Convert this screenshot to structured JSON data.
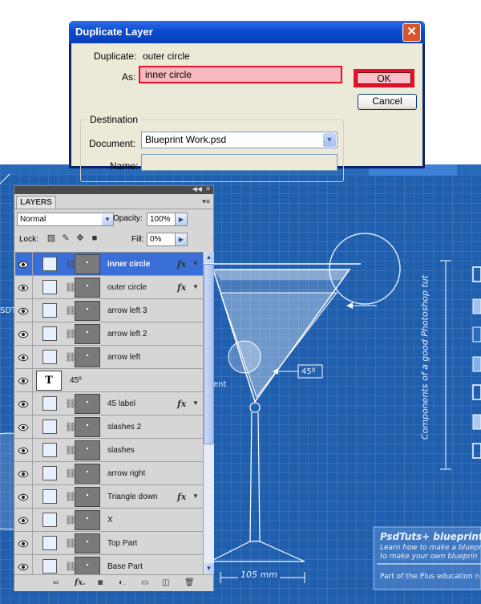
{
  "dialog": {
    "title": "Duplicate Layer",
    "duplicate_label": "Duplicate:",
    "duplicate_value": "outer circle",
    "as_label": "As:",
    "as_value": "inner circle",
    "ok_label": "OK",
    "cancel_label": "Cancel",
    "destination_label": "Destination",
    "document_label": "Document:",
    "document_value": "Blueprint Work.psd",
    "name_label": "Name:",
    "name_value": ""
  },
  "layers_panel": {
    "tab_label": "LAYERS",
    "blend_mode": "Normal",
    "opacity_label": "Opacity:",
    "opacity_value": "100%",
    "lock_label": "Lock:",
    "fill_label": "Fill:",
    "fill_value": "0%",
    "layers": [
      {
        "name": "inner circle",
        "selected": true,
        "fx": true,
        "type": "shape"
      },
      {
        "name": "outer circle",
        "selected": false,
        "fx": true,
        "type": "shape"
      },
      {
        "name": "arrow left 3",
        "selected": false,
        "fx": false,
        "type": "shape"
      },
      {
        "name": "arrow left 2",
        "selected": false,
        "fx": false,
        "type": "shape"
      },
      {
        "name": "arrow left",
        "selected": false,
        "fx": false,
        "type": "shape"
      },
      {
        "name": "45º",
        "selected": false,
        "fx": false,
        "type": "text",
        "thumb_label": "T"
      },
      {
        "name": "45 label",
        "selected": false,
        "fx": true,
        "type": "shape"
      },
      {
        "name": "slashes 2",
        "selected": false,
        "fx": false,
        "type": "shape"
      },
      {
        "name": "slashes",
        "selected": false,
        "fx": false,
        "type": "shape"
      },
      {
        "name": "arrow right",
        "selected": false,
        "fx": false,
        "type": "shape"
      },
      {
        "name": "Triangle down",
        "selected": false,
        "fx": true,
        "type": "shape"
      },
      {
        "name": "X",
        "selected": false,
        "fx": false,
        "type": "shape"
      },
      {
        "name": "Top Part",
        "selected": false,
        "fx": false,
        "type": "shape"
      },
      {
        "name": "Base Part",
        "selected": false,
        "fx": false,
        "type": "shape"
      }
    ],
    "fx_label": "fx"
  },
  "blueprint": {
    "vertical_caption": "Components of a good Photoshop tut",
    "angle_label": "45º",
    "dimension_label": "105 mm",
    "partial_label_ent": "ent",
    "partial_left_sdt": "SDT",
    "promo_title": "PsdTuts+ blueprint t",
    "promo_line1": "Learn how to make a bluepri",
    "promo_line2": "to make your own blueprin",
    "promo_footer": "Part of the Plus education n"
  }
}
